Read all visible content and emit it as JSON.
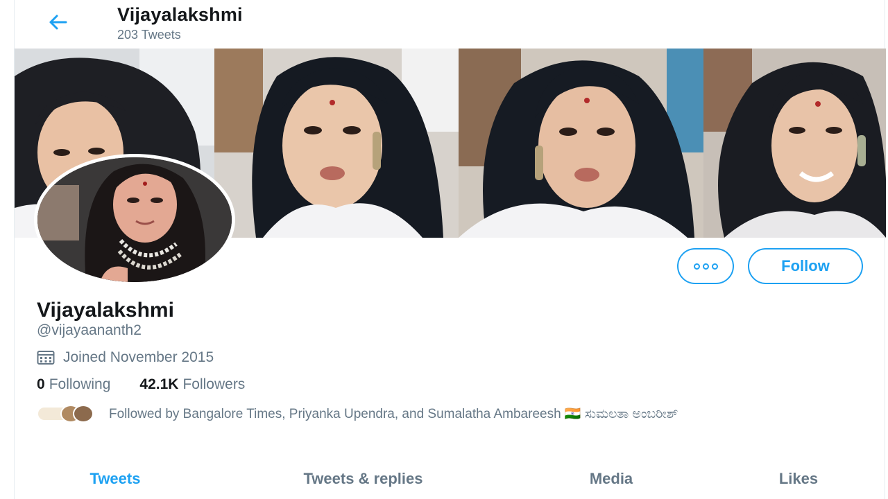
{
  "header": {
    "name": "Vijayalakshmi",
    "tweet_count": "203 Tweets",
    "back_icon": "arrow-left-icon"
  },
  "profile": {
    "name": "Vijayalakshmi",
    "handle": "@vijayaananth2",
    "joined": "Joined November 2015",
    "following_count": "0",
    "following_label": "Following",
    "followers_count": "42.1K",
    "followers_label": "Followers",
    "followed_by": "Followed by Bangalore Times, Priyanka Upendra, and Sumalatha Ambareesh 🇮🇳 ಸುಮಲತಾ ಅಂಬರೀಶ್"
  },
  "actions": {
    "more_icon": "more-options-icon",
    "follow_label": "Follow"
  },
  "tabs": [
    {
      "label": "Tweets",
      "active": true
    },
    {
      "label": "Tweets & replies",
      "active": false
    },
    {
      "label": "Media",
      "active": false
    },
    {
      "label": "Likes",
      "active": false
    }
  ],
  "colors": {
    "accent": "#1da1f2",
    "text_primary": "#14171a",
    "text_secondary": "#657786"
  }
}
